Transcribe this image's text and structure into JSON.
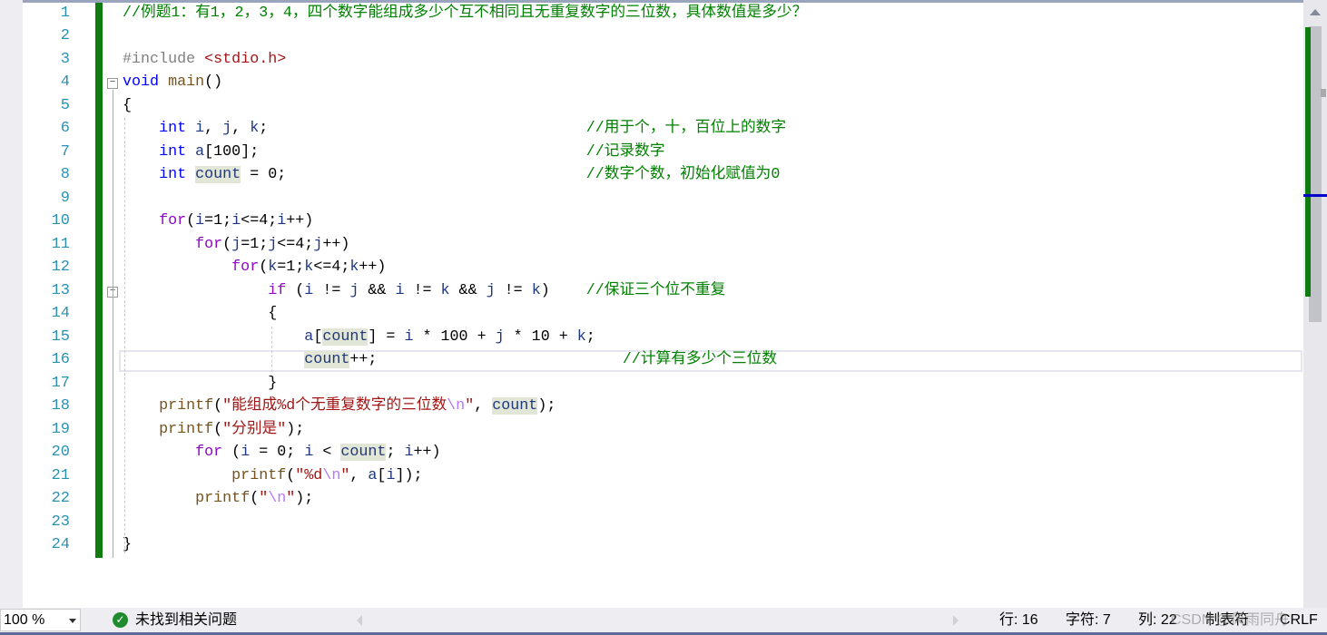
{
  "editor": {
    "lines": [
      [
        [
          "cm",
          "//例题1：有1，2，3，4，四个数字能组成多少个互不相同且无重复数字的三位数，具体数值是多少？"
        ]
      ],
      [],
      [
        [
          "pp",
          "#include "
        ],
        [
          "inc",
          "<stdio.h>"
        ]
      ],
      [
        [
          "kw",
          "void"
        ],
        [
          "p",
          " "
        ],
        [
          "fn",
          "main"
        ],
        [
          "p",
          "()"
        ]
      ],
      [
        [
          "p",
          "{"
        ]
      ],
      [
        [
          "p",
          "    "
        ],
        [
          "kw",
          "int"
        ],
        [
          "p",
          " "
        ],
        [
          "id",
          "i"
        ],
        [
          "p",
          ", "
        ],
        [
          "id",
          "j"
        ],
        [
          "p",
          ", "
        ],
        [
          "id",
          "k"
        ],
        [
          "p",
          ";"
        ],
        [
          "p",
          "                                   "
        ],
        [
          "cm",
          "//用于个，十，百位上的数字"
        ]
      ],
      [
        [
          "p",
          "    "
        ],
        [
          "kw",
          "int"
        ],
        [
          "p",
          " "
        ],
        [
          "id",
          "a"
        ],
        [
          "p",
          "[100];"
        ],
        [
          "p",
          "                                    "
        ],
        [
          "cm",
          "//记录数字"
        ]
      ],
      [
        [
          "p",
          "    "
        ],
        [
          "kw",
          "int"
        ],
        [
          "p",
          " "
        ],
        [
          "hl",
          "count"
        ],
        [
          "p",
          " = 0;"
        ],
        [
          "p",
          "                                 "
        ],
        [
          "cm",
          "//数字个数，初始化赋值为0"
        ]
      ],
      [],
      [
        [
          "p",
          "    "
        ],
        [
          "ctl",
          "for"
        ],
        [
          "p",
          "("
        ],
        [
          "id",
          "i"
        ],
        [
          "p",
          "=1;"
        ],
        [
          "id",
          "i"
        ],
        [
          "p",
          "<=4;"
        ],
        [
          "id",
          "i"
        ],
        [
          "p",
          "++)"
        ]
      ],
      [
        [
          "p",
          "        "
        ],
        [
          "ctl",
          "for"
        ],
        [
          "p",
          "("
        ],
        [
          "id",
          "j"
        ],
        [
          "p",
          "=1;"
        ],
        [
          "id",
          "j"
        ],
        [
          "p",
          "<=4;"
        ],
        [
          "id",
          "j"
        ],
        [
          "p",
          "++)"
        ]
      ],
      [
        [
          "p",
          "            "
        ],
        [
          "ctl",
          "for"
        ],
        [
          "p",
          "("
        ],
        [
          "id",
          "k"
        ],
        [
          "p",
          "=1;"
        ],
        [
          "id",
          "k"
        ],
        [
          "p",
          "<=4;"
        ],
        [
          "id",
          "k"
        ],
        [
          "p",
          "++)"
        ]
      ],
      [
        [
          "p",
          "                "
        ],
        [
          "ctl",
          "if"
        ],
        [
          "p",
          " ("
        ],
        [
          "id",
          "i"
        ],
        [
          "p",
          " != "
        ],
        [
          "id",
          "j"
        ],
        [
          "p",
          " && "
        ],
        [
          "id",
          "i"
        ],
        [
          "p",
          " != "
        ],
        [
          "id",
          "k"
        ],
        [
          "p",
          " && "
        ],
        [
          "id",
          "j"
        ],
        [
          "p",
          " != "
        ],
        [
          "id",
          "k"
        ],
        [
          "p",
          ")"
        ],
        [
          "p",
          "    "
        ],
        [
          "cm",
          "//保证三个位不重复"
        ]
      ],
      [
        [
          "p",
          "                {"
        ]
      ],
      [
        [
          "p",
          "                    "
        ],
        [
          "id",
          "a"
        ],
        [
          "p",
          "["
        ],
        [
          "hl",
          "count"
        ],
        [
          "p",
          "] = "
        ],
        [
          "id",
          "i"
        ],
        [
          "p",
          " * 100 + "
        ],
        [
          "id",
          "j"
        ],
        [
          "p",
          " * 10 + "
        ],
        [
          "id",
          "k"
        ],
        [
          "p",
          ";"
        ]
      ],
      [
        [
          "p",
          "                    "
        ],
        [
          "hl",
          "count"
        ],
        [
          "p",
          "++;"
        ],
        [
          "p",
          "                           "
        ],
        [
          "cm",
          "//计算有多少个三位数"
        ]
      ],
      [
        [
          "p",
          "                }"
        ]
      ],
      [
        [
          "p",
          "    "
        ],
        [
          "fn",
          "printf"
        ],
        [
          "p",
          "("
        ],
        [
          "str",
          "\"能组成%d个无重复数字的三位数"
        ],
        [
          "esc",
          "\\n"
        ],
        [
          "str",
          "\""
        ],
        [
          "p",
          ", "
        ],
        [
          "hl",
          "count"
        ],
        [
          "p",
          ");"
        ]
      ],
      [
        [
          "p",
          "    "
        ],
        [
          "fn",
          "printf"
        ],
        [
          "p",
          "("
        ],
        [
          "str",
          "\"分别是\""
        ],
        [
          "p",
          ");"
        ]
      ],
      [
        [
          "p",
          "        "
        ],
        [
          "ctl",
          "for"
        ],
        [
          "p",
          " ("
        ],
        [
          "id",
          "i"
        ],
        [
          "p",
          " = 0; "
        ],
        [
          "id",
          "i"
        ],
        [
          "p",
          " < "
        ],
        [
          "hl",
          "count"
        ],
        [
          "p",
          "; "
        ],
        [
          "id",
          "i"
        ],
        [
          "p",
          "++)"
        ]
      ],
      [
        [
          "p",
          "            "
        ],
        [
          "fn",
          "printf"
        ],
        [
          "p",
          "("
        ],
        [
          "str",
          "\"%d"
        ],
        [
          "esc",
          "\\n"
        ],
        [
          "str",
          "\""
        ],
        [
          "p",
          ", "
        ],
        [
          "id",
          "a"
        ],
        [
          "p",
          "["
        ],
        [
          "id",
          "i"
        ],
        [
          "p",
          "]);"
        ]
      ],
      [
        [
          "p",
          "        "
        ],
        [
          "fn",
          "printf"
        ],
        [
          "p",
          "("
        ],
        [
          "str",
          "\""
        ],
        [
          "esc",
          "\\n"
        ],
        [
          "str",
          "\""
        ],
        [
          "p",
          ");"
        ]
      ],
      [],
      [
        [
          "p",
          "}"
        ]
      ]
    ],
    "current_line": 16,
    "fold_markers": [
      "−",
      "−"
    ]
  },
  "status": {
    "zoom": "100 %",
    "issues": "未找到相关问题",
    "issues_icon": "check-circle-icon",
    "row": "行: 16",
    "char": "字符: 7",
    "col": "列: 22",
    "tabs": "制表符",
    "eol": "CRLF",
    "watermark": "CSDN @风雨同舟"
  },
  "colors": {
    "accent_green": "#107c10",
    "line_number": "#2b91af",
    "keyword": "#0000ff",
    "control": "#8f08c4",
    "comment": "#008000"
  }
}
